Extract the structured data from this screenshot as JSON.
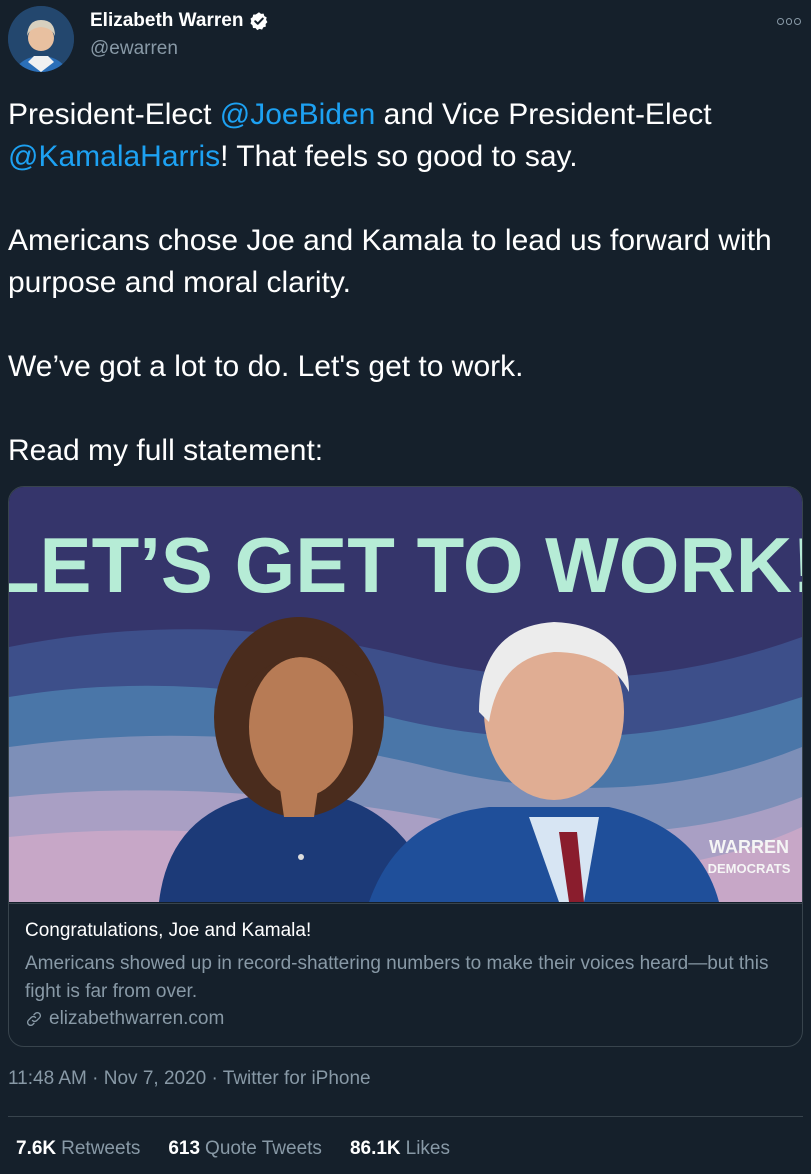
{
  "author": {
    "display_name": "Elizabeth Warren",
    "handle": "@ewarren",
    "avatar_icon": "avatar-photo",
    "verified_icon": "verified-badge-icon"
  },
  "tweet": {
    "line1_pre": "President-Elect ",
    "mention1": "@JoeBiden",
    "line1_mid": " and Vice President-Elect ",
    "mention2": "@KamalaHarris",
    "line1_post": "! That feels so good to say.",
    "para2": "Americans chose Joe and Kamala to lead us forward with purpose and moral clarity.",
    "para3": "We’ve got a lot to do. Let's get to work.",
    "para4": "Read my full statement:"
  },
  "card": {
    "image_headline": "LET’S GET TO WORK!",
    "image_logo_line1": "WARREN",
    "image_logo_line2": "DEMOCRATS",
    "title": "Congratulations, Joe and Kamala!",
    "description": "Americans showed up in record-shattering numbers to make their voices heard—but this fight is far from over.",
    "domain": "elizabethwarren.com"
  },
  "meta": {
    "time": "11:48 AM",
    "sep1": " · ",
    "date": "Nov 7, 2020",
    "sep2": " · ",
    "source": "Twitter for iPhone"
  },
  "stats": [
    {
      "count": "7.6K",
      "label": "Retweets"
    },
    {
      "count": "613",
      "label": "Quote Tweets"
    },
    {
      "count": "86.1K",
      "label": "Likes"
    }
  ],
  "colors": {
    "background": "#15202b",
    "mention": "#1da1f2",
    "secondary_text": "#8899a6",
    "headline_mint": "#b6ecd6",
    "card_bg": "#35356b"
  }
}
